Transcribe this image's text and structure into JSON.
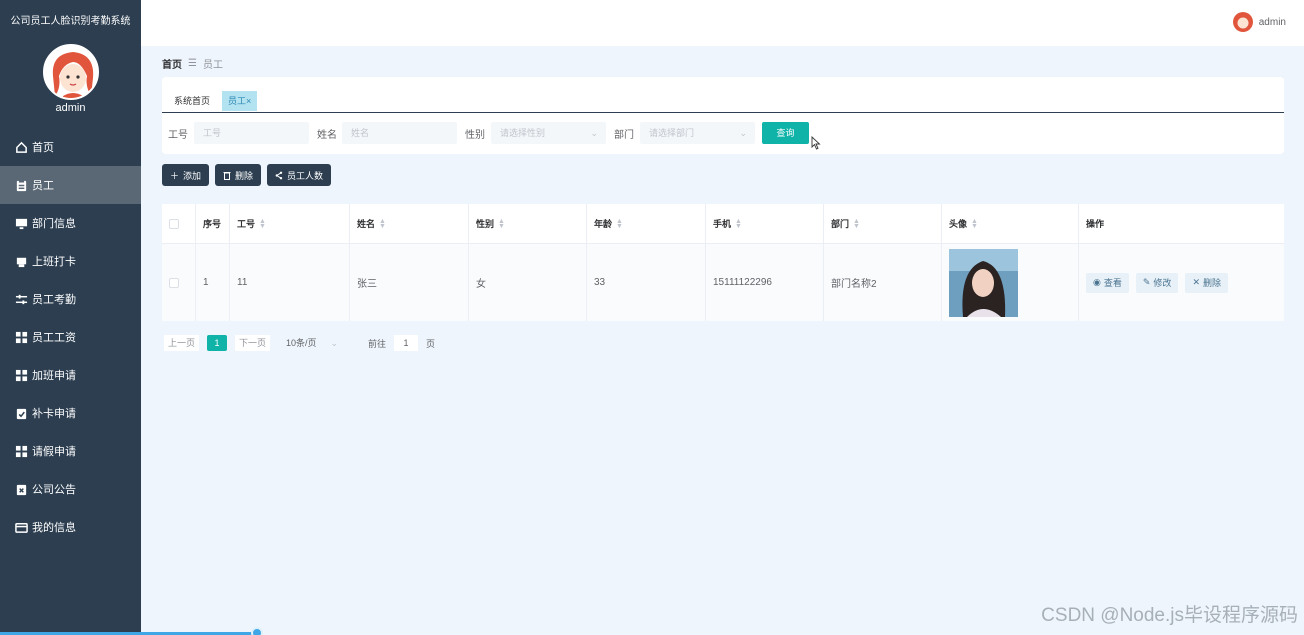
{
  "app": {
    "title": "公司员工人脸识别考勤系统",
    "user": "admin",
    "accent_color": "#0fb3a8",
    "sidebar_color": "#2c3e50"
  },
  "sidebar": {
    "username": "admin",
    "items": [
      {
        "label": "首页",
        "icon": "home-icon"
      },
      {
        "label": "员工",
        "icon": "clipboard-icon"
      },
      {
        "label": "部门信息",
        "icon": "monitor-icon"
      },
      {
        "label": "上班打卡",
        "icon": "printer-icon"
      },
      {
        "label": "员工考勤",
        "icon": "sliders-icon"
      },
      {
        "label": "员工工资",
        "icon": "grid-icon"
      },
      {
        "label": "加班申请",
        "icon": "grid-icon"
      },
      {
        "label": "补卡申请",
        "icon": "clipboard-check-icon"
      },
      {
        "label": "请假申请",
        "icon": "grid-icon"
      },
      {
        "label": "公司公告",
        "icon": "clipboard-x-icon"
      },
      {
        "label": "我的信息",
        "icon": "card-icon"
      }
    ],
    "active_index": 1
  },
  "breadcrumb": {
    "home": "首页",
    "separator": "☰",
    "current": "员工"
  },
  "tabs": [
    {
      "label": "系统首页"
    },
    {
      "label": "员工",
      "closable": true,
      "close": "×"
    }
  ],
  "search": {
    "fields": [
      {
        "label": "工号",
        "placeholder": "工号"
      },
      {
        "label": "姓名",
        "placeholder": "姓名"
      },
      {
        "label": "性别",
        "placeholder": "请选择性别"
      },
      {
        "label": "部门",
        "placeholder": "请选择部门"
      }
    ],
    "query_button": "查询"
  },
  "actions": {
    "add": "添加",
    "delete": "删除",
    "count": "员工人数"
  },
  "table": {
    "columns": [
      "序号",
      "工号",
      "姓名",
      "性别",
      "年龄",
      "手机",
      "部门",
      "头像",
      "操作"
    ],
    "rows": [
      {
        "index": "1",
        "emp_no": "11",
        "name": "张三",
        "gender": "女",
        "age": "33",
        "phone": "15111122296",
        "dept": "部门名称2"
      }
    ],
    "row_actions": {
      "view": "查看",
      "edit": "修改",
      "delete": "删除"
    }
  },
  "pager": {
    "prev": "上一页",
    "page": "1",
    "next": "下一页",
    "size": "10条/页",
    "goto_prefix": "前往",
    "goto_value": "1",
    "goto_suffix": "页"
  },
  "watermark": "CSDN @Node.js毕设程序源码"
}
